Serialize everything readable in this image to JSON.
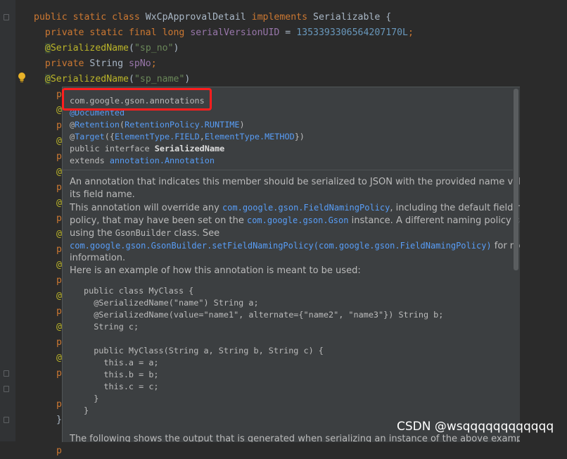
{
  "editor": {
    "lines": [
      {
        "parts": [
          [
            "kw",
            "public static class "
          ],
          [
            "cls",
            "WxCpApprovalDetail "
          ],
          [
            "kw",
            "implements "
          ],
          [
            "cls",
            "Serializable {"
          ]
        ]
      },
      {
        "parts": [
          [
            "kw",
            "  private static final long "
          ],
          [
            "fld",
            "serialVersionUID"
          ],
          [
            "plain",
            " = "
          ],
          [
            "num",
            "1353393306564207170L"
          ],
          [
            "kw",
            ";"
          ]
        ]
      },
      {
        "parts": [
          [
            "annhl",
            "  @"
          ],
          [
            "ann",
            "SerializedName"
          ],
          [
            "plain",
            "("
          ],
          [
            "str",
            "\"sp_no\""
          ],
          [
            "plain",
            ")"
          ]
        ]
      },
      {
        "parts": [
          [
            "kw",
            "  private "
          ],
          [
            "cls",
            "String "
          ],
          [
            "fld",
            "spNo"
          ],
          [
            "kw",
            ";"
          ]
        ]
      },
      {
        "parts": [
          [
            "annhl",
            "  @"
          ],
          [
            "ann",
            "SerializedName"
          ],
          [
            "plain",
            "("
          ],
          [
            "str",
            "\"sp_name\""
          ],
          [
            "plain",
            ")"
          ]
        ]
      }
    ],
    "stub_rows": [
      "p",
      "@",
      "p",
      "@",
      "p",
      "@",
      "p",
      "@",
      "p",
      "@",
      "p",
      "@",
      "p",
      "@",
      "p",
      "@",
      "p",
      "@",
      "p"
    ],
    "tail_lines": [
      "p",
      "}",
      "",
      "p"
    ]
  },
  "doc_popup": {
    "package": "com.google.gson.annotations",
    "documented": "@Documented",
    "retention_prefix": "@",
    "retention_name": "Retention",
    "retention_open": "(",
    "retention_policy": "RetentionPolicy",
    "retention_dot": ".",
    "retention_value": "RUNTIME",
    "retention_close": ")",
    "target_prefix": "@",
    "target_name": "Target",
    "target_open": "({",
    "element_type_1": "ElementType",
    "field": ".FIELD",
    "comma": ",",
    "element_type_2": "ElementType",
    "method": ".METHOD",
    "target_close": "})",
    "interface_prefix": "public interface ",
    "interface_name": "SerializedName",
    "extends_prefix": "extends ",
    "extends_link": "annotation.Annotation",
    "desc_lines": [
      "An annotation that indicates this member should be serialized to JSON with the provided name value as",
      "its field name."
    ],
    "override_1": "This annotation will override any ",
    "override_link": "com.google.gson.FieldNamingPolicy",
    "override_2": ", including the default field naming",
    "policy_1": "policy, that may have been set on the ",
    "policy_link": "com.google.gson.Gson",
    "policy_2": " instance. A different naming policy can set",
    "using_1": "using the ",
    "using_code": "GsonBuilder",
    "using_2": " class. See",
    "builder_link": "com.google.gson.GsonBuilder.setFieldNamingPolicy(com.google.gson.FieldNamingPolicy)",
    "builder_after": " for more",
    "information": "information.",
    "example_intro": "Here is an example of how this annotation is meant to be used:",
    "example_code": [
      "public class MyClass {",
      "  @SerializedName(\"name\") String a;",
      "  @SerializedName(value=\"name1\", alternate={\"name2\", \"name3\"}) String b;",
      "  String c;",
      "",
      "  public MyClass(String a, String b, String c) {",
      "    this.a = a;",
      "    this.b = b;",
      "    this.c = c;",
      "  }",
      "}"
    ],
    "cutoff_text": "The following shows the output that is generated when serializing an instance of the above example class"
  },
  "watermark": "CSDN @wsqqqqqqqqqqqq"
}
